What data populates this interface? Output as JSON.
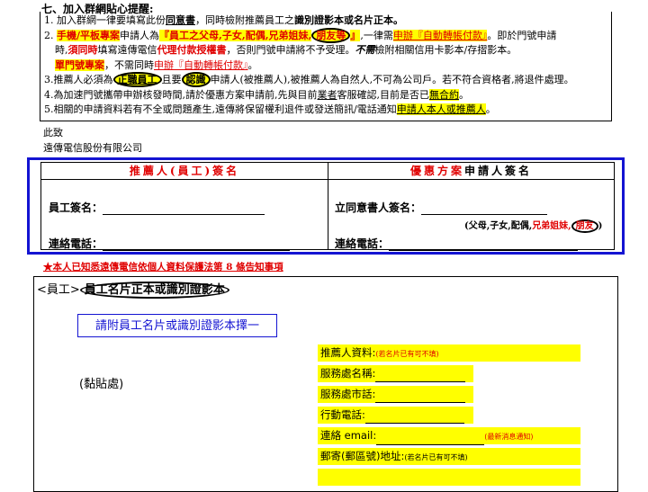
{
  "header": "七、加入群網貼心提醒:",
  "notice": {
    "l1a": "1. 加入群網一律要填寫此份",
    "l1b": "同意書",
    "l1c": "，同時檢附推薦員工之",
    "l1d": "識別證影本或名片正本。",
    "l2a": "2. ",
    "l2b": "手機/平板專案",
    "l2c": "申請人為",
    "l2d": "『員工之父母,子女,配偶,兄弟姐妹,",
    "l2e": "朋友等",
    "l2f": "』",
    "l2g": ",一律需",
    "l2h": "申辦『自動轉帳付款』",
    "l2i": "。即於門號申請",
    "l3a": "時,",
    "l3b": "須同時",
    "l3c": "填寫遠傳電信",
    "l3d": "代理付款授權書",
    "l3e": "，否則門號申請將不予受理。",
    "l3f": "不需",
    "l3g": "檢附相關信用卡影本/存摺影本。",
    "l4a": "單門號專案",
    "l4b": "，不需同時",
    "l4c": "申辦『自動轉帳付款』",
    "l4d": "。",
    "l5a": "3.推薦人必須為",
    "l5b": "正職員工",
    "l5c": "且要",
    "l5d": "認識",
    "l5e": "申請人(被推薦人),被推薦人為自然人,不可為公司戶。若不符合資格者,將退件處理。",
    "l6a": "4.為加速門號攜帶申辦核發時間,請於優惠方案申請前,先與目前",
    "l6b": "業者",
    "l6c": "客服確認,目前是否已",
    "l6d": "無合約",
    "l6e": "。",
    "l7a": "5.相關的申請資料若有不全或問題產生,遠傳將保留權利退件或發送簡訊/電話通知",
    "l7b": "申請人本人或推薦人",
    "l7c": "。"
  },
  "closing": {
    "to": "此致",
    "company": "遠傳電信股份有限公司"
  },
  "sign": {
    "left_header": "推薦人(員工)簽名",
    "right_header_a": "優惠方案",
    "right_header_b": "申請人簽名",
    "emp_sign": "員工簽名：",
    "emp_phone": "連絡電話：",
    "app_sign": "立同意書人簽名：",
    "app_phone": "連絡電話：",
    "rel_a": "(父母,子女,配偶,",
    "rel_b": "兄弟姐妹,",
    "rel_c": "朋友",
    "rel_d": ")"
  },
  "privacy": "★本人已知悉遠傳電信依個人資料保護法第 8 條告知事項",
  "attach": {
    "prefix": "<員工>",
    "title": "員工名片正本或識別證影本",
    "box": "請附員工名片或識別證影本擇一",
    "paste": "(黏貼處)"
  },
  "ref": {
    "title": "推薦人資料:",
    "title_note": "(若名片已有可不填)",
    "company": "服務處名稱:",
    "office": "服務處市話:",
    "mobile": "行動電話:",
    "email": "連絡 email:",
    "email_note": "(最新消息通知)",
    "address": "郵寄(郵區號)地址:",
    "address_note": "(若名片已有可不填)"
  }
}
